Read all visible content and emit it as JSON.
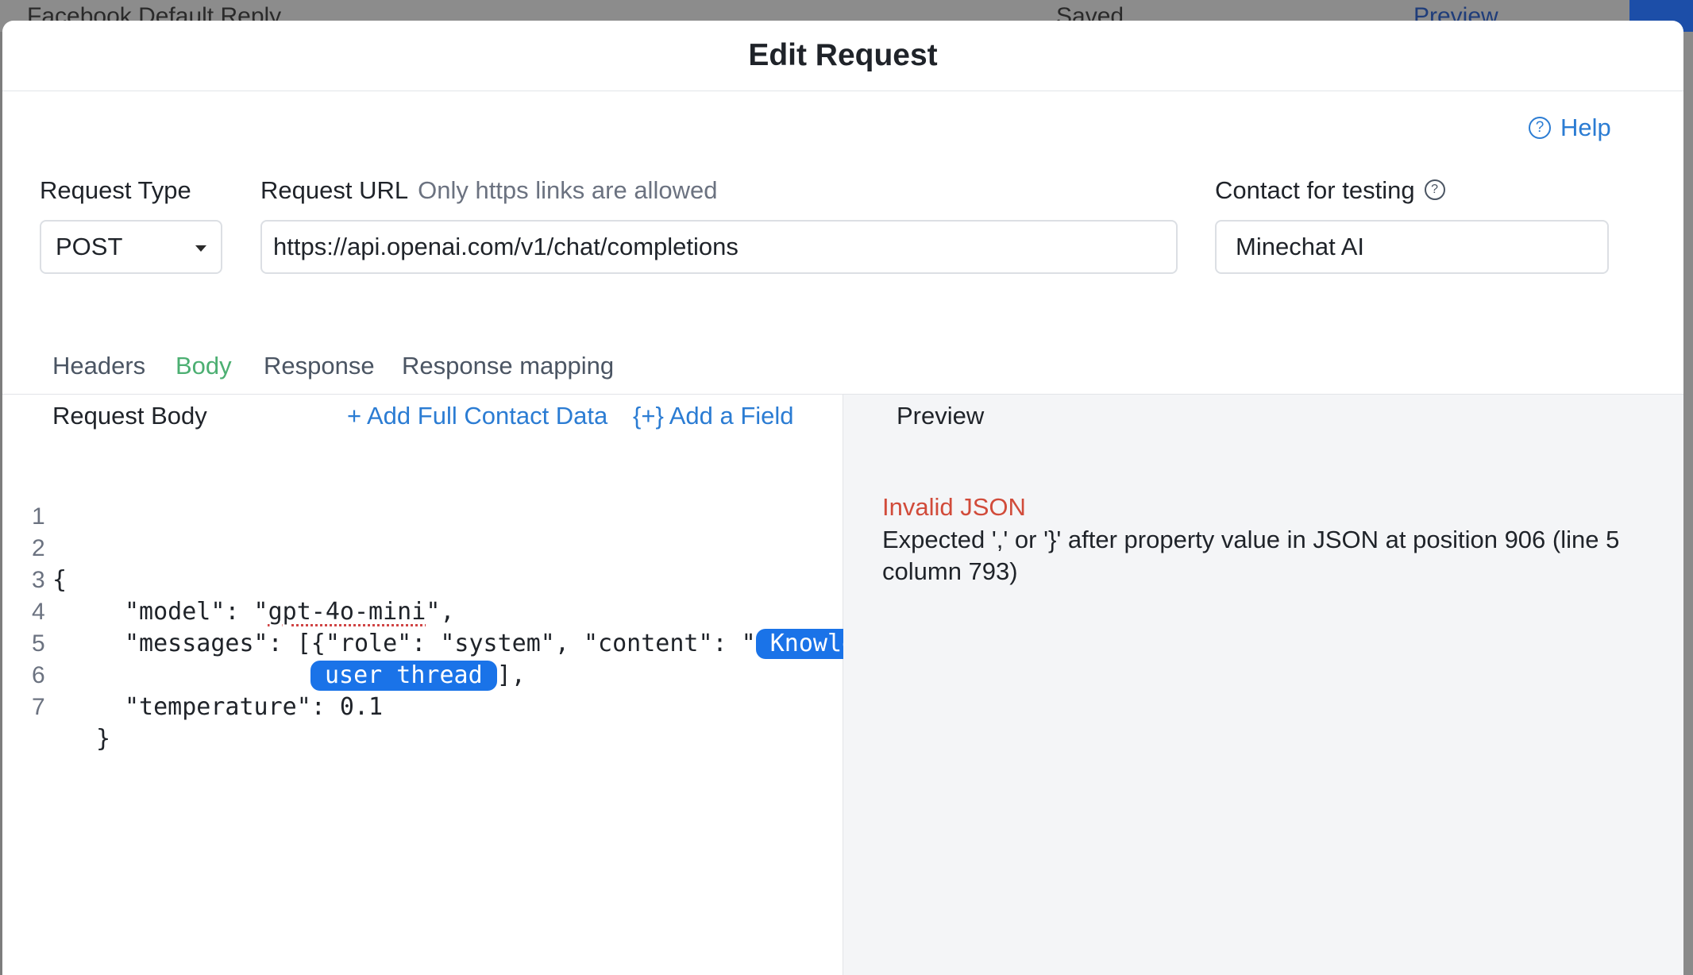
{
  "background": {
    "title": "Facebook Default Reply",
    "saved": "Saved",
    "preview": "Preview"
  },
  "modal": {
    "title": "Edit Request",
    "help": "Help",
    "request_type": {
      "label": "Request Type",
      "value": "POST"
    },
    "request_url": {
      "label": "Request URL",
      "hint": "Only https links are allowed",
      "value": "https://api.openai.com/v1/chat/completions"
    },
    "contact": {
      "label": "Contact for testing",
      "value": "Minechat AI"
    },
    "tabs": [
      "Headers",
      "Body",
      "Response",
      "Response mapping"
    ],
    "active_tab": "Body",
    "body": {
      "title": "Request Body",
      "add_full_contact": "+ Add Full Contact Data",
      "add_field": "{+} Add a Field",
      "lines": [
        {
          "n": "1",
          "text": ""
        },
        {
          "n": "2",
          "text": "{"
        },
        {
          "n": "3",
          "pre": "\"model\": \"",
          "squiggle": "gpt-4o-mini",
          "post": "\","
        },
        {
          "n": "4",
          "pre": "\"messages\": [{\"role\": \"system\", \"content\": \"",
          "pill": "Knowle"
        },
        {
          "n": "5",
          "pill": "user thread",
          "post": "],"
        },
        {
          "n": "6",
          "text": "\"temperature\": 0.1"
        },
        {
          "n": "7",
          "text": "}"
        }
      ]
    },
    "preview": {
      "title": "Preview",
      "error_title": "Invalid JSON",
      "error_message": "Expected ',' or '}' after property value in JSON at position 906 (line 5 column 793)"
    }
  },
  "colors": {
    "accent": "#2b7cd3",
    "active_tab": "#4caf72",
    "error": "#d14b3a",
    "pill": "#1a73e8"
  }
}
